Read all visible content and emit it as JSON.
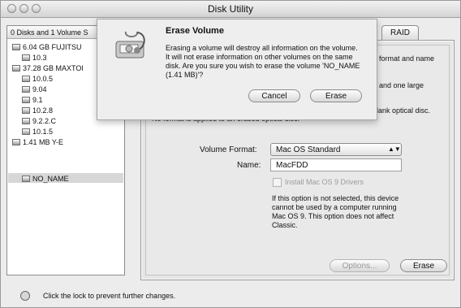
{
  "window": {
    "title": "Disk Utility"
  },
  "sidebar": {
    "header": "0 Disks and 1 Volume S",
    "items": [
      "6.04 GB FUJITSU",
      "10.3",
      "37.28 GB MAXTOI",
      "10.0.5",
      "9.04",
      "9.1",
      "10.2.8",
      "9.2.2.C",
      "10.1.5",
      "1.41 MB Y-E",
      "NO_NAME"
    ]
  },
  "tabs": {
    "raid": "RAID"
  },
  "main": {
    "partial_1": "format and name",
    "partial_2": "and one large",
    "partial_3": "blank optical disc.",
    "note": "No format is applied to an erased optical disc.",
    "volume_format_label": "Volume Format:",
    "volume_format_value": "Mac OS Standard",
    "name_label": "Name:",
    "name_value": "MacFDD",
    "install_label": "Install Mac OS 9 Drivers",
    "install_note": "If this option is not selected, this device cannot be used by a computer running Mac OS 9. This option does not affect Classic.",
    "options_button": "Options...",
    "erase_button": "Erase"
  },
  "dialog": {
    "title": "Erase Volume",
    "message": "Erasing a volume will destroy all information on the volume. It will not erase information on other volumes on the same disk. Are you sure you wish to erase the volume 'NO_NAME (1.41 MB)'?",
    "cancel": "Cancel",
    "erase": "Erase"
  },
  "footer": {
    "lock_text": "Click the lock to prevent further changes."
  },
  "colors": {
    "selection": "#d7d7d7",
    "window": "#ececec"
  }
}
